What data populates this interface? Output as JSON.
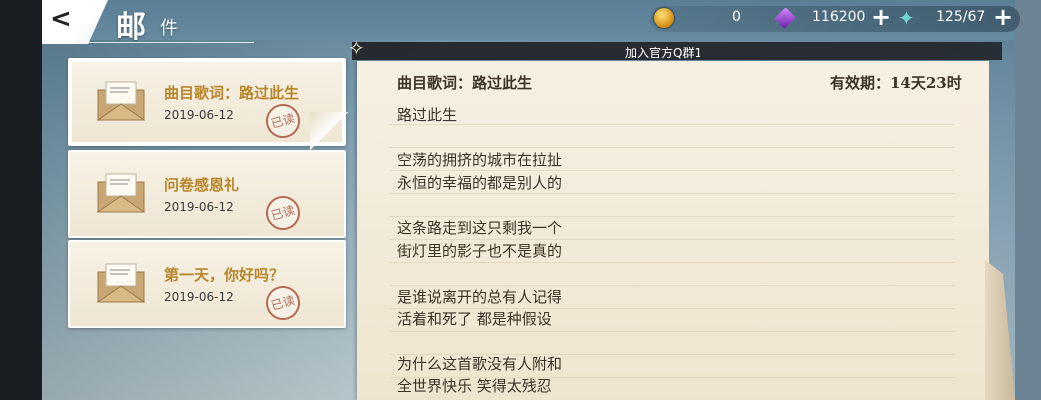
{
  "header": {
    "back_label": "<",
    "title_main": "邮",
    "title_sub": "件"
  },
  "currencies": {
    "gold": {
      "icon": "gold-coin-icon",
      "value": "0"
    },
    "gem": {
      "icon": "purple-gem-icon",
      "value": "116200",
      "plus": "+"
    },
    "stamina": {
      "icon": "stamina-icon",
      "value": "125/67",
      "plus": "+"
    }
  },
  "notice": {
    "text": "加入官方Q群1"
  },
  "mails": [
    {
      "subject": "曲目歌词：路过此生",
      "date": "2019-06-12",
      "stamp": "已读",
      "selected": true
    },
    {
      "subject": "问卷感恩礼",
      "date": "2019-06-12",
      "stamp": "已读",
      "selected": false
    },
    {
      "subject": "第一天，你好吗？",
      "date": "2019-06-12",
      "stamp": "已读",
      "selected": false
    }
  ],
  "detail": {
    "title": "曲目歌词：路过此生",
    "expiry": "有效期：14天23时",
    "lines": [
      "路过此生",
      "空荡的拥挤的城市在拉扯",
      "永恒的幸福的都是别人的",
      "这条路走到这只剩我一个",
      "街灯里的影子也不是真的",
      "是谁说离开的总有人记得",
      "活着和死了 都是种假设",
      "为什么这首歌没有人附和",
      "全世界快乐 笑得太残忍"
    ]
  }
}
